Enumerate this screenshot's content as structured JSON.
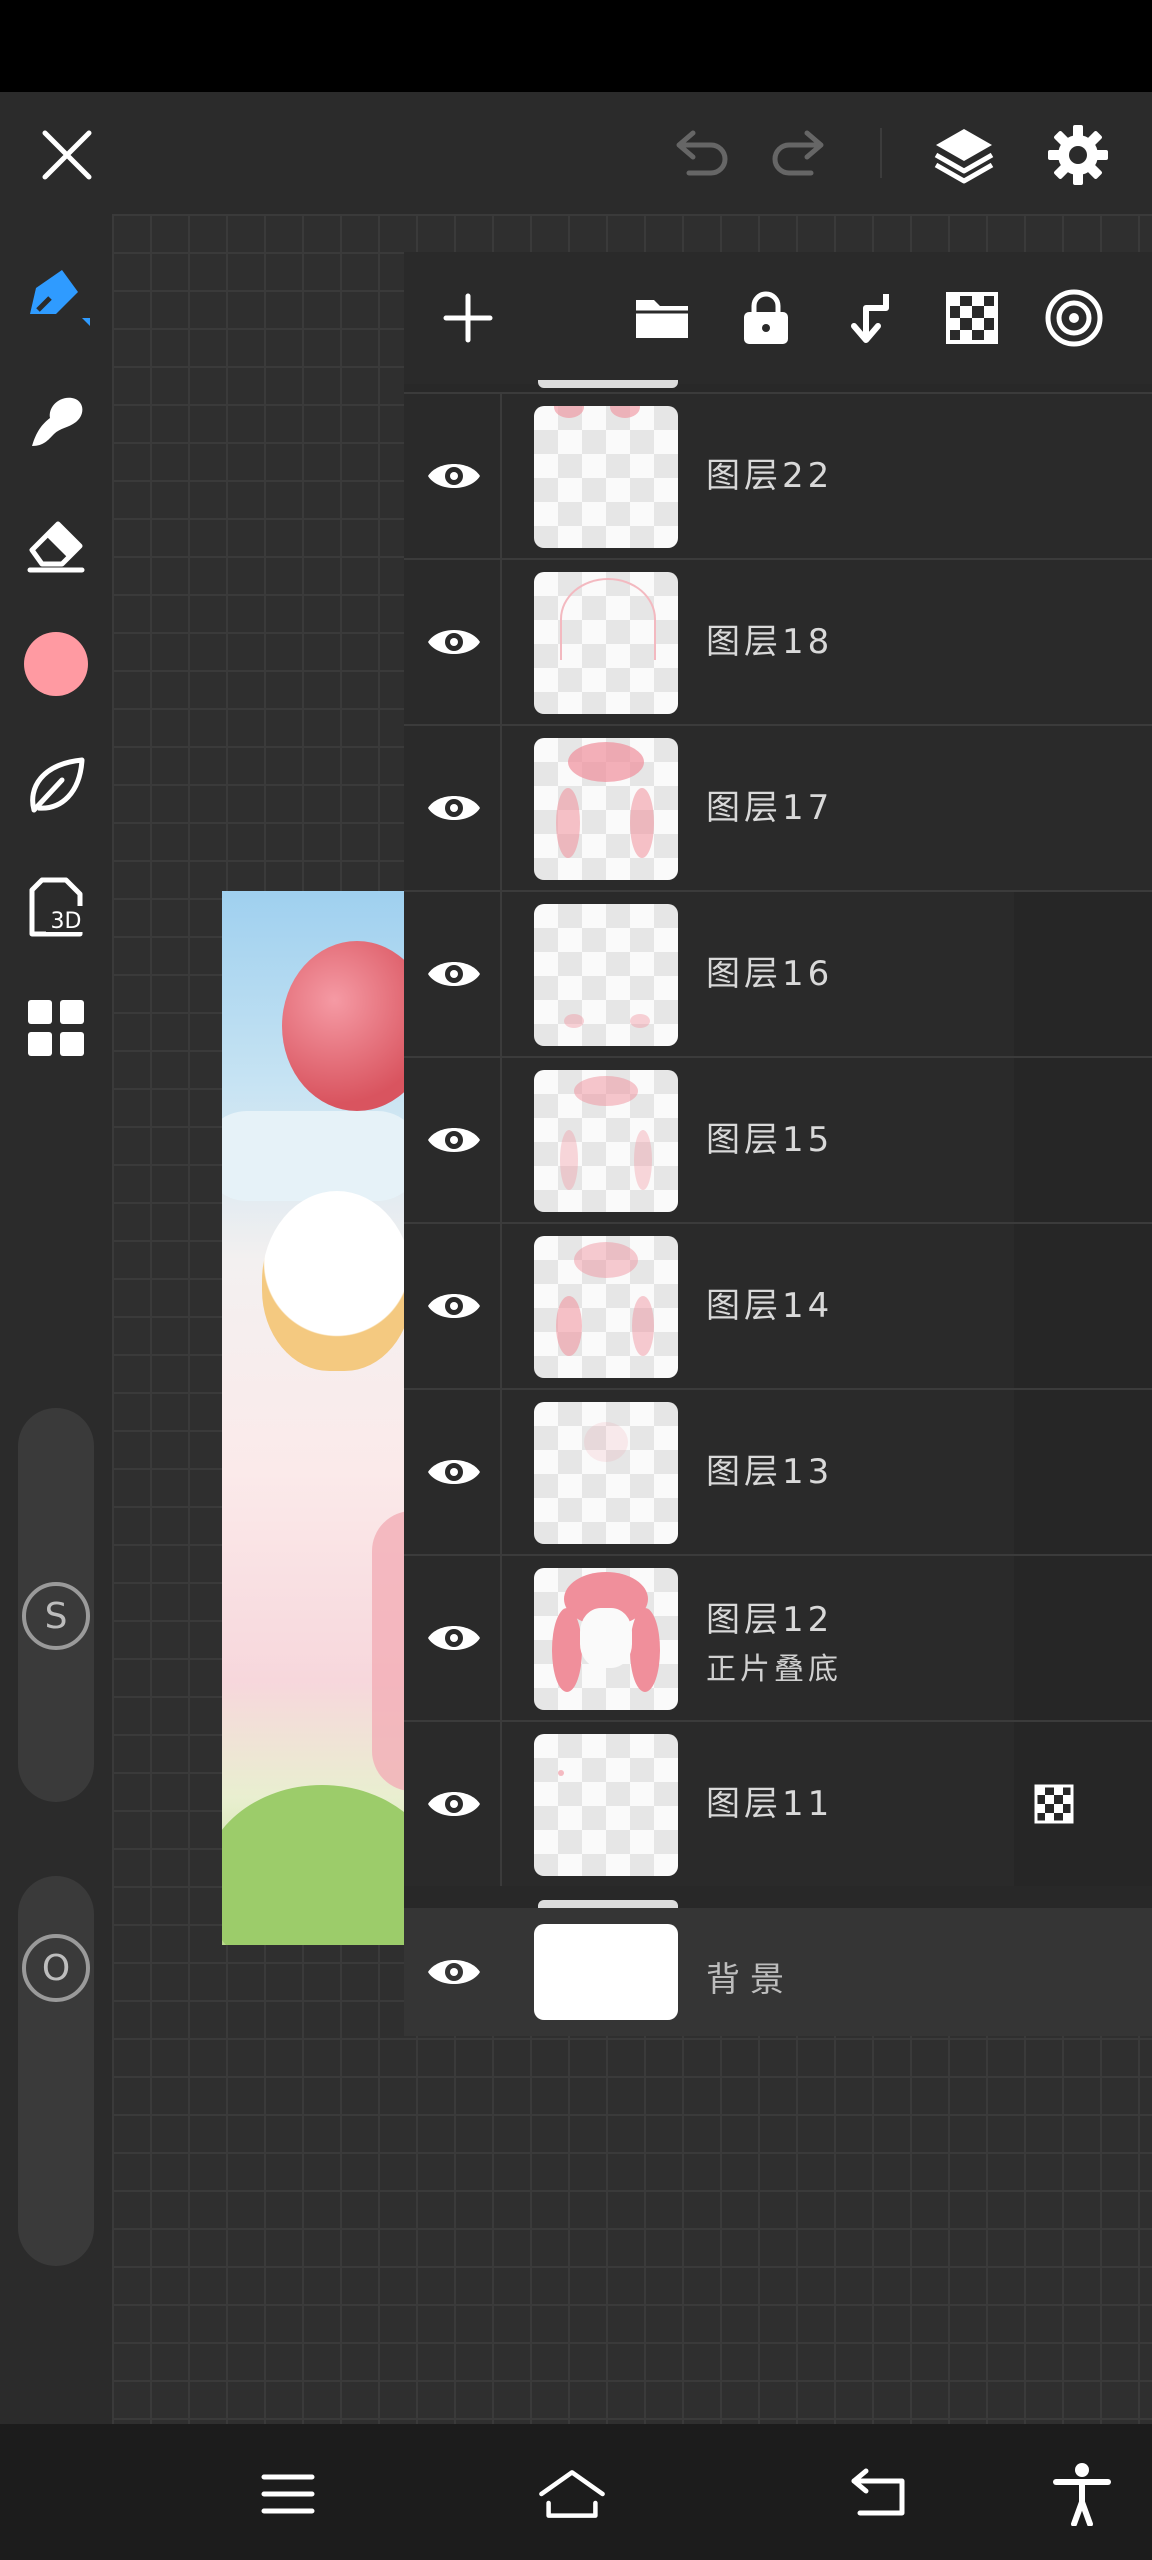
{
  "colors": {
    "accent": "#2f9bff",
    "brush_color": "#ff9aa2",
    "panel_bg": "#282828",
    "canvas_bg": "#2f2f2f"
  },
  "topbar": {
    "icons": [
      "close-icon",
      "undo-icon",
      "redo-icon",
      "layers-icon",
      "gear-icon"
    ]
  },
  "tools": [
    {
      "name": "pen-tool",
      "icon": "pen-icon",
      "active": true
    },
    {
      "name": "smudge-tool",
      "icon": "smudge-icon"
    },
    {
      "name": "eraser-tool",
      "icon": "eraser-icon"
    },
    {
      "name": "color-swatch",
      "icon": "color-circle"
    },
    {
      "name": "shape-tool",
      "icon": "leaf-icon"
    },
    {
      "name": "3d-tool",
      "icon": "3d-icon",
      "label": "3D"
    },
    {
      "name": "apps-tool",
      "icon": "grid-icon"
    }
  ],
  "sliders": {
    "size_label": "S",
    "opacity_label": "O"
  },
  "layers_toolbar": {
    "icons": [
      "plus-icon",
      "folder-icon",
      "lock-icon",
      "merge-down-icon",
      "checkerboard-icon",
      "target-icon"
    ]
  },
  "layers": [
    {
      "name": "图层22"
    },
    {
      "name": "图层18"
    },
    {
      "name": "图层17"
    },
    {
      "name": "图层16"
    },
    {
      "name": "图层15"
    },
    {
      "name": "图层14"
    },
    {
      "name": "图层13"
    },
    {
      "name": "图层12",
      "blend": "正片叠底"
    },
    {
      "name": "图层11",
      "extra_icon": "checkerboard-icon"
    }
  ],
  "background_layer": {
    "name": "背景"
  },
  "navbar": {
    "icons": [
      "menu-icon",
      "home-icon",
      "back-icon",
      "accessibility-icon"
    ]
  }
}
